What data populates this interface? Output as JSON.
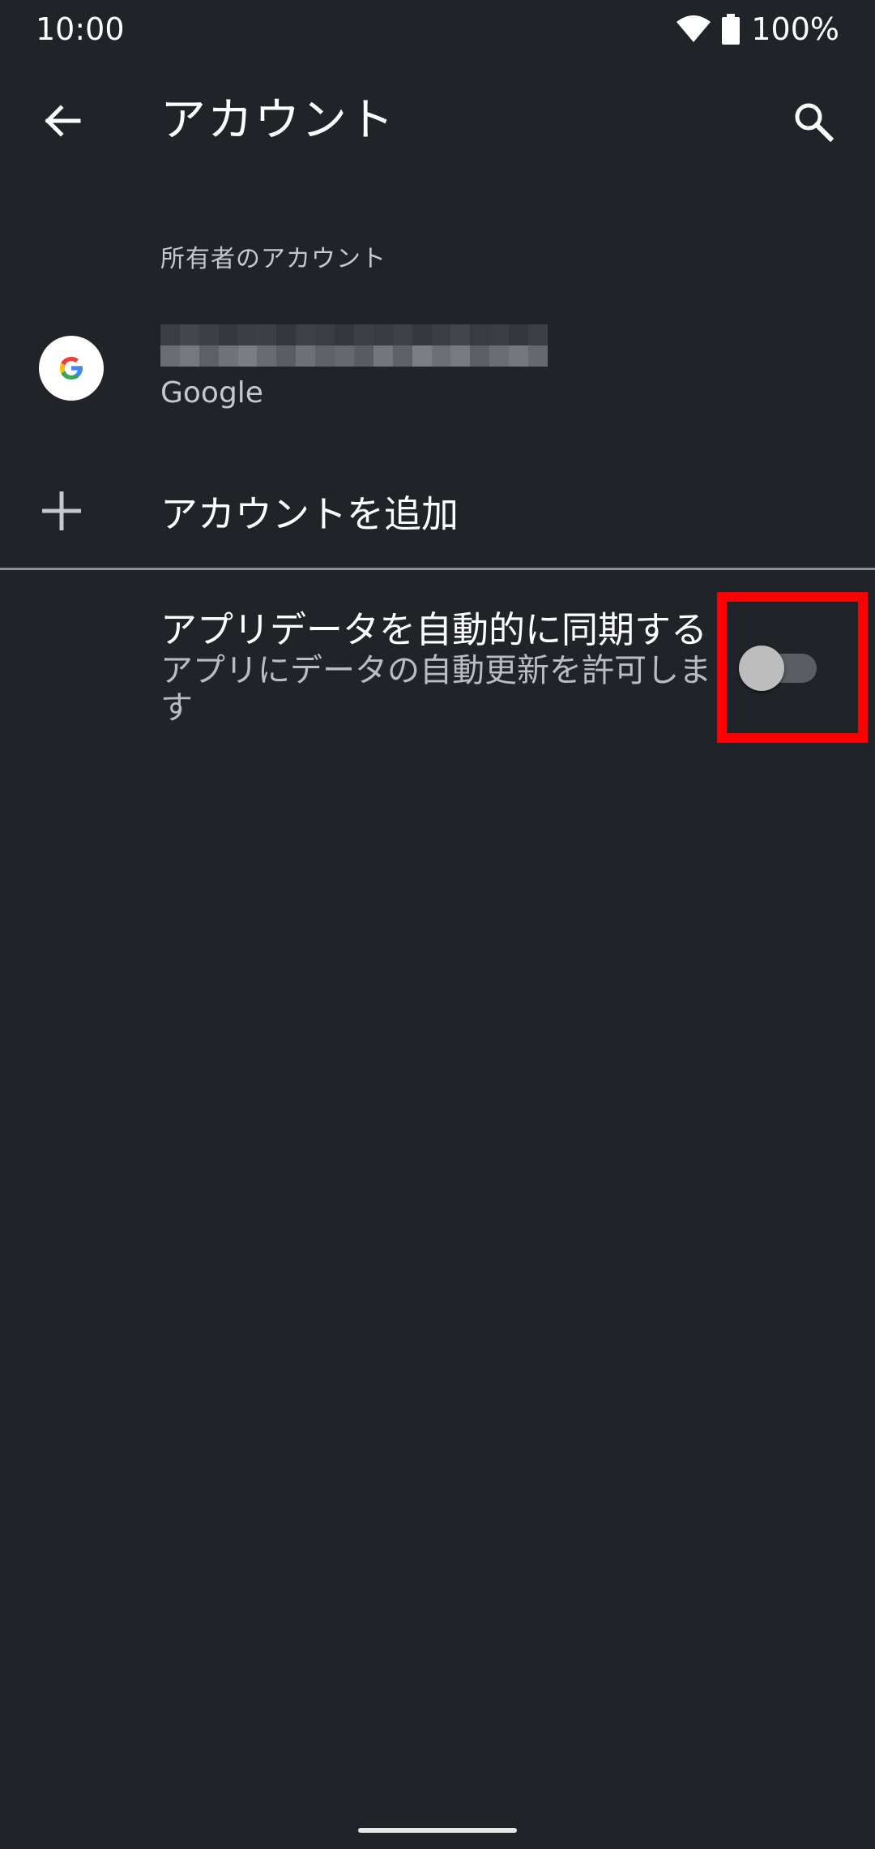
{
  "status_bar": {
    "time": "10:00",
    "battery": "100%",
    "icons": [
      "wifi-icon",
      "battery-icon"
    ]
  },
  "app_bar": {
    "title": "アカウント",
    "back_icon": "arrow-back-icon",
    "search_icon": "search-icon"
  },
  "section": {
    "header": "所有者のアカウント"
  },
  "account": {
    "type": "Google",
    "icon": "google-icon"
  },
  "add_account": {
    "label": "アカウントを追加",
    "icon": "plus-icon"
  },
  "auto_sync": {
    "title": "アプリデータを自動的に同期する",
    "summary": "アプリにデータの自動更新を許可します",
    "enabled": false
  },
  "colors": {
    "background": "#202328",
    "highlight": "#ff0000"
  }
}
